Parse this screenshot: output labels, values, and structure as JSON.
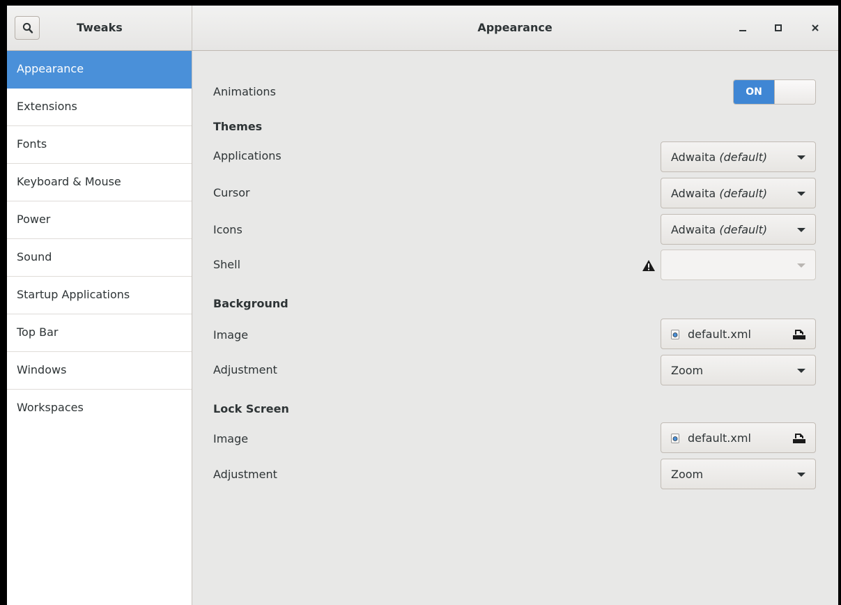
{
  "header": {
    "app_title": "Tweaks",
    "window_title": "Appearance",
    "search_icon": "search-icon",
    "controls": [
      "minimize-icon",
      "maximize-icon",
      "close-icon"
    ]
  },
  "sidebar": {
    "items": [
      {
        "label": "Appearance",
        "selected": true
      },
      {
        "label": "Extensions"
      },
      {
        "label": "Fonts"
      },
      {
        "label": "Keyboard & Mouse"
      },
      {
        "label": "Power"
      },
      {
        "label": "Sound"
      },
      {
        "label": "Startup Applications"
      },
      {
        "label": "Top Bar"
      },
      {
        "label": "Windows"
      },
      {
        "label": "Workspaces"
      }
    ]
  },
  "main": {
    "animations": {
      "label": "Animations",
      "toggle_text": "ON",
      "state": true
    },
    "themes": {
      "heading": "Themes",
      "applications": {
        "label": "Applications",
        "value": "Adwaita",
        "suffix": "(default)"
      },
      "cursor": {
        "label": "Cursor",
        "value": "Adwaita",
        "suffix": "(default)"
      },
      "icons": {
        "label": "Icons",
        "value": "Adwaita",
        "suffix": "(default)"
      },
      "shell": {
        "label": "Shell",
        "value": "",
        "warning_icon": "warning-icon"
      }
    },
    "background": {
      "heading": "Background",
      "image": {
        "label": "Image",
        "value": "default.xml"
      },
      "adjustment": {
        "label": "Adjustment",
        "value": "Zoom"
      }
    },
    "lock_screen": {
      "heading": "Lock Screen",
      "image": {
        "label": "Image",
        "value": "default.xml"
      },
      "adjustment": {
        "label": "Adjustment",
        "value": "Zoom"
      }
    }
  },
  "colors": {
    "accent": "#4a90d9",
    "toggle_on": "#3f86d4"
  }
}
